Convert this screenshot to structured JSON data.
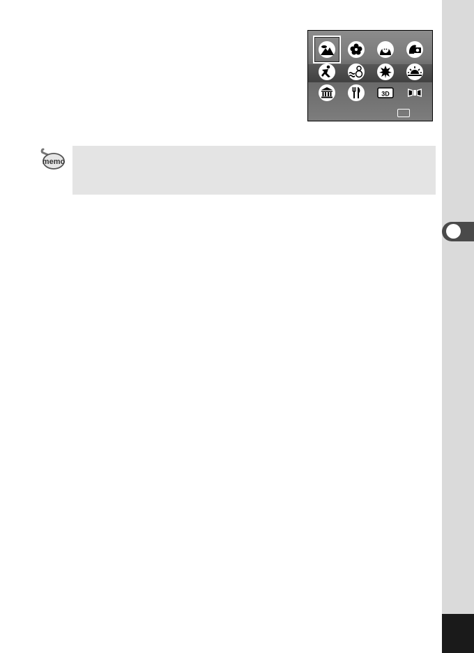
{
  "memo": {
    "icon_label": "memo"
  },
  "lcd": {
    "icons": [
      {
        "name": "landscape-icon",
        "selected": true
      },
      {
        "name": "flower-icon"
      },
      {
        "name": "portrait-icon"
      },
      {
        "name": "self-portrait-icon"
      },
      {
        "name": "sport-icon"
      },
      {
        "name": "surf-snow-icon"
      },
      {
        "name": "autumn-icon"
      },
      {
        "name": "sunset-icon"
      },
      {
        "name": "museum-icon"
      },
      {
        "name": "food-icon"
      },
      {
        "name": "3d-icon",
        "label": "3D"
      },
      {
        "name": "panorama-icon"
      }
    ]
  },
  "colors": {
    "side_strip": "#dadada",
    "chapter_tab": "#4a4a4a",
    "page_corner": "#1a1a1a",
    "memo_box": "#e4e4e4"
  }
}
